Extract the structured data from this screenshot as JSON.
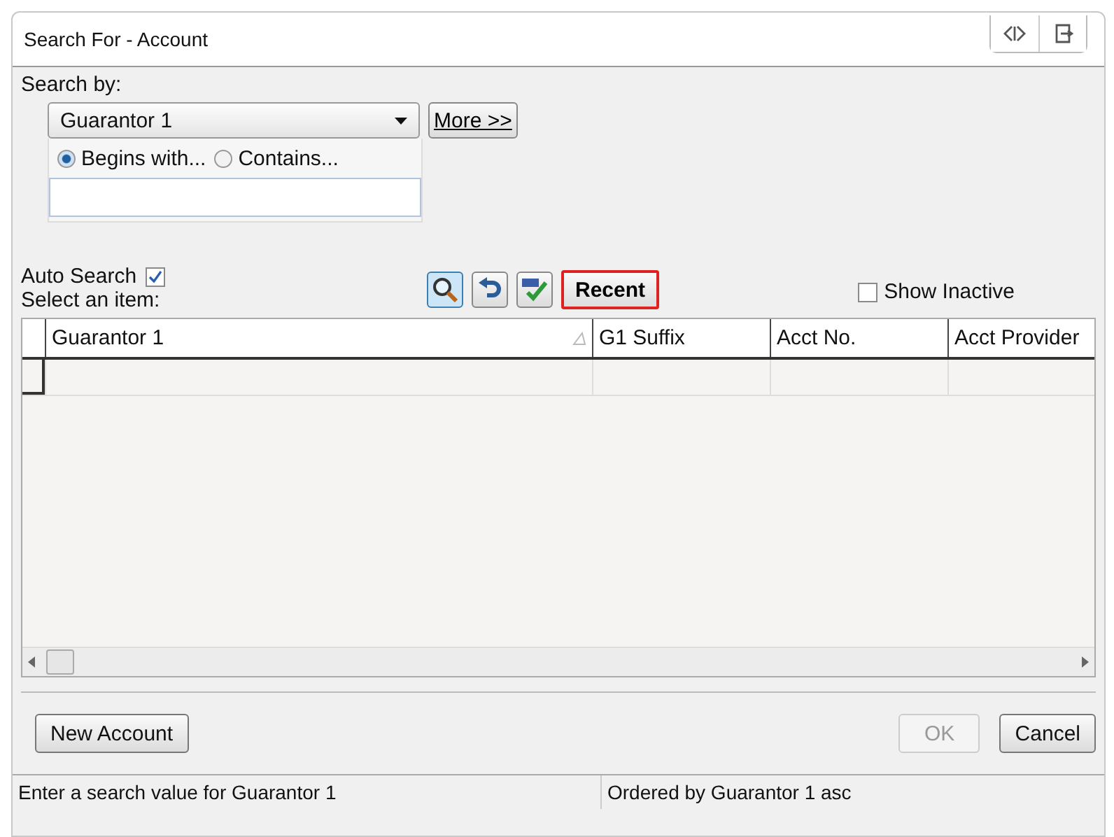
{
  "window": {
    "title": "Search For - Account"
  },
  "search_by": {
    "label": "Search by:",
    "field": "Guarantor 1",
    "more_button": "More >>",
    "match_modes": [
      {
        "label": "Begins with...",
        "selected": true
      },
      {
        "label": "Contains...",
        "selected": false
      }
    ]
  },
  "auto_search": {
    "label": "Auto Search",
    "checked": true
  },
  "select_label": "Select an item:",
  "recent_button": "Recent",
  "show_inactive": {
    "label": "Show Inactive",
    "checked": false
  },
  "table": {
    "columns": [
      {
        "label": "Guarantor 1",
        "sorted": true
      },
      {
        "label": "G1 Suffix",
        "sorted": false
      },
      {
        "label": "Acct No.",
        "sorted": false
      },
      {
        "label": "Acct Provider",
        "sorted": false
      }
    ]
  },
  "buttons": [
    {
      "label": "New Account",
      "disabled": false
    },
    {
      "label": "OK",
      "disabled": true
    },
    {
      "label": "Cancel",
      "disabled": false
    }
  ],
  "status_bar": [
    "Enter a search value for Guarantor 1",
    "Ordered by Guarantor 1 asc"
  ]
}
